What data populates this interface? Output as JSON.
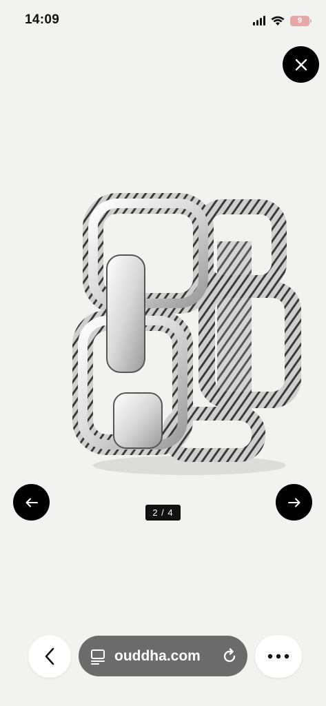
{
  "status_bar": {
    "time": "14:09",
    "battery_level": "9",
    "icons": [
      "signal-icon",
      "wifi-icon",
      "battery-icon"
    ]
  },
  "viewer": {
    "close_icon": "close-icon",
    "pager": "2 / 4",
    "prev_icon": "arrow-left-icon",
    "next_icon": "arrow-right-icon"
  },
  "browser": {
    "url": "ouddha.com",
    "back_icon": "chevron-left-icon",
    "tabs_icon": "page-menu-icon",
    "reload_icon": "reload-icon",
    "more_icon": "more-icon"
  },
  "colors": {
    "background": "#f2f2f0",
    "button": "#000000",
    "url_bar": "#6b6b6b",
    "battery": "#e7a7a7"
  }
}
